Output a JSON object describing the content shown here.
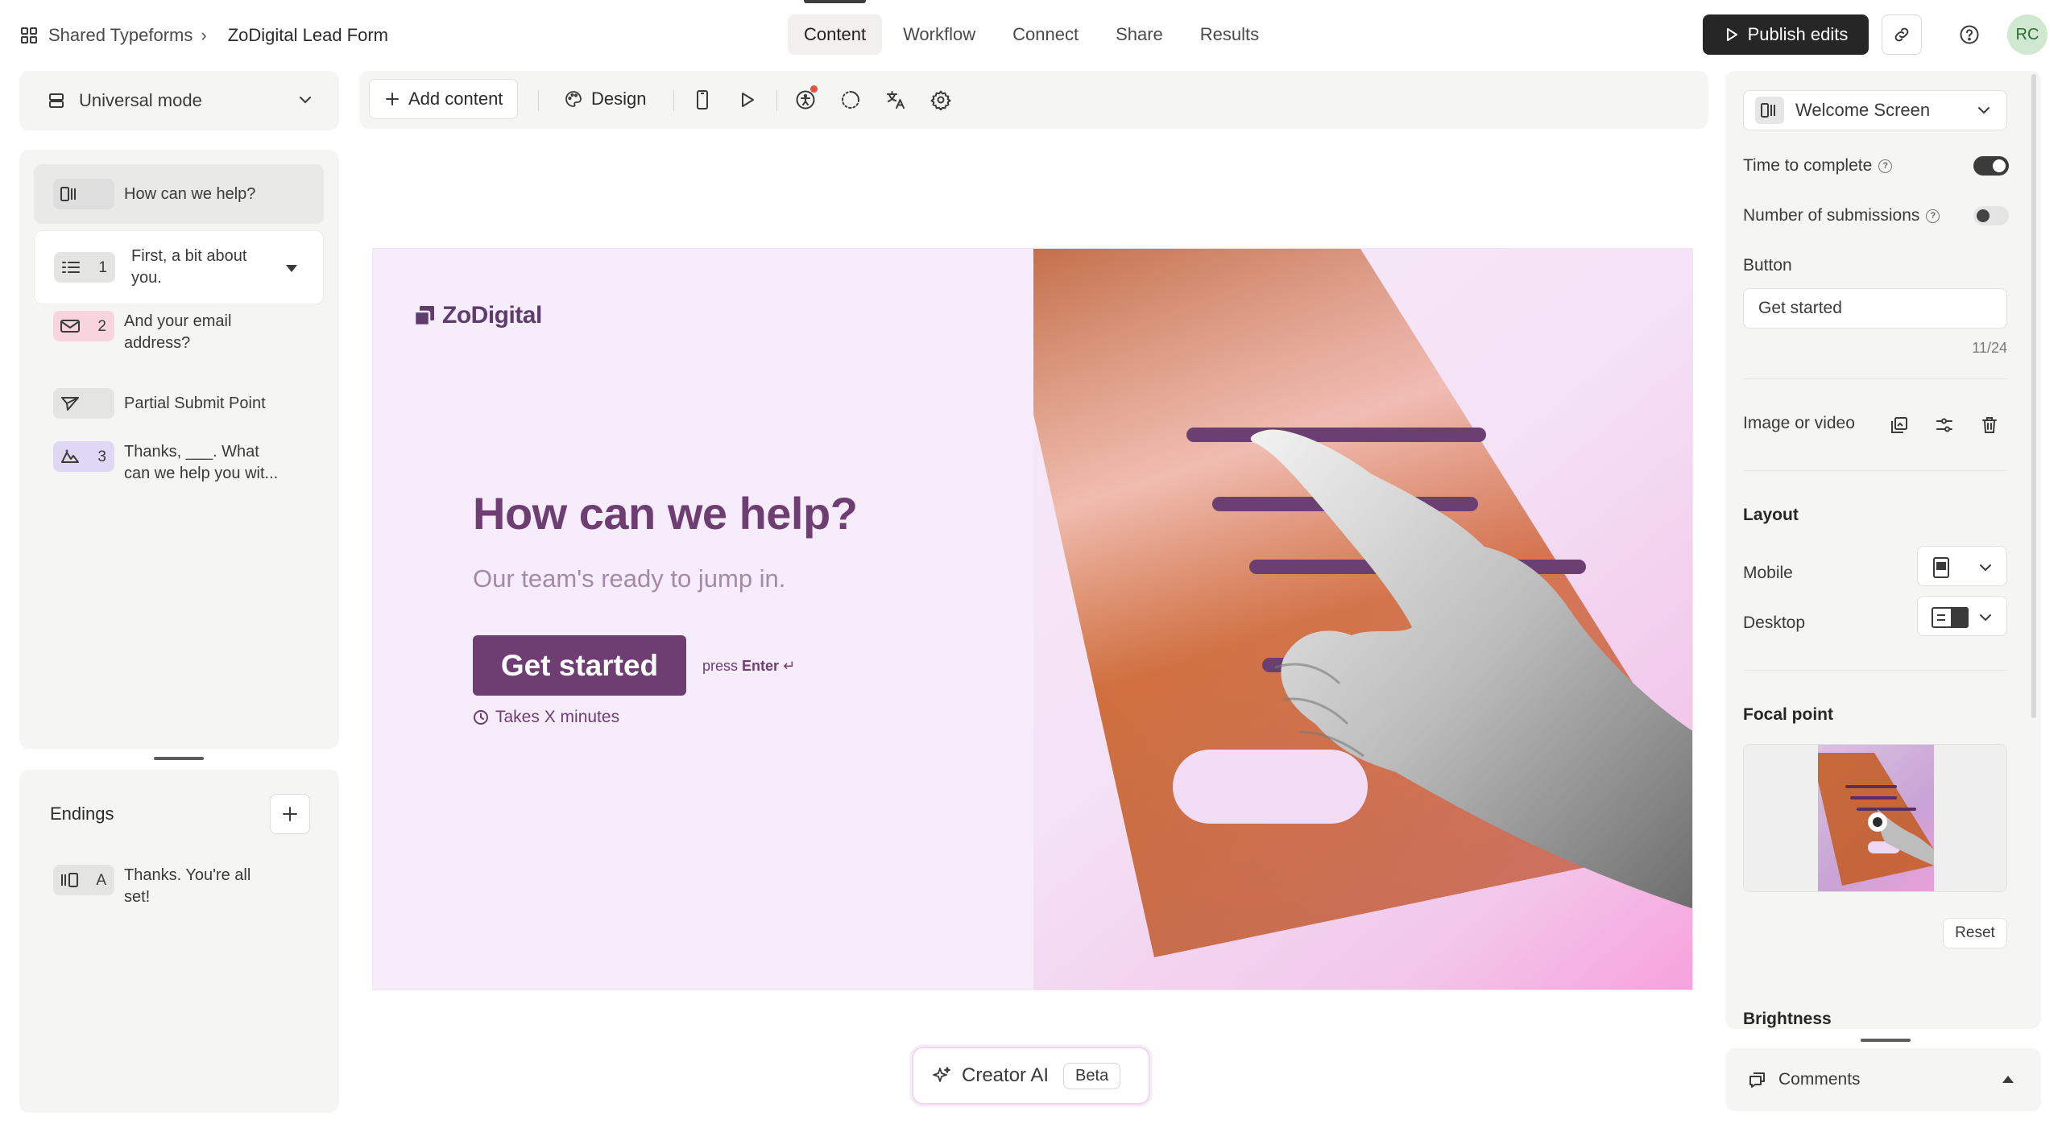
{
  "breadcrumb": {
    "workspace": "Shared Typeforms",
    "separator": "›",
    "form": "ZoDigital Lead Form"
  },
  "nav": {
    "tabs": [
      "Content",
      "Workflow",
      "Connect",
      "Share",
      "Results"
    ],
    "active": "Content"
  },
  "header": {
    "publish_label": "Publish edits",
    "avatar_initials": "RC"
  },
  "sidebar": {
    "mode_label": "Universal mode",
    "questions": [
      {
        "number": "",
        "text": "How can we help?",
        "icon": "welcome-screen-icon"
      },
      {
        "number": "1",
        "text": "First, a bit about you.",
        "icon": "contact-info-icon"
      },
      {
        "number": "2",
        "text": "And your email address?",
        "icon": "email-icon"
      },
      {
        "number": "",
        "text": "Partial Submit Point",
        "icon": "send-icon"
      },
      {
        "number": "3",
        "text": "Thanks, ___. What can we help you wit...",
        "icon": "long-text-icon"
      }
    ],
    "endings_title": "Endings",
    "endings": [
      {
        "letter": "A",
        "text": "Thanks. You're all set!",
        "icon": "ending-screen-icon"
      }
    ]
  },
  "toolbar": {
    "add_content_label": "Add content",
    "design_label": "Design"
  },
  "preview": {
    "logo_text": "ZoDigital",
    "headline": "How can we help?",
    "subheadline": "Our team's ready to jump in.",
    "button_label": "Get started",
    "press_prefix": "press",
    "press_key": "Enter",
    "press_symbol": "↵",
    "time_text": "Takes X minutes"
  },
  "creator_ai": {
    "label": "Creator AI",
    "badge": "Beta"
  },
  "settings": {
    "screen_type": "Welcome Screen",
    "time_to_complete": {
      "label": "Time to complete",
      "enabled": true
    },
    "number_of_submissions": {
      "label": "Number of submissions",
      "enabled": false
    },
    "button_label": "Button",
    "button_value": "Get started",
    "button_counter": "11/24",
    "image_or_video_label": "Image or video",
    "layout_label": "Layout",
    "mobile_label": "Mobile",
    "desktop_label": "Desktop",
    "focal_point_label": "Focal point",
    "reset_label": "Reset",
    "brightness_label": "Brightness"
  },
  "comments": {
    "label": "Comments"
  },
  "colors": {
    "brand": "#6e3e72",
    "publish_bg": "#262627",
    "toggle_on": "#3b3b3b"
  }
}
